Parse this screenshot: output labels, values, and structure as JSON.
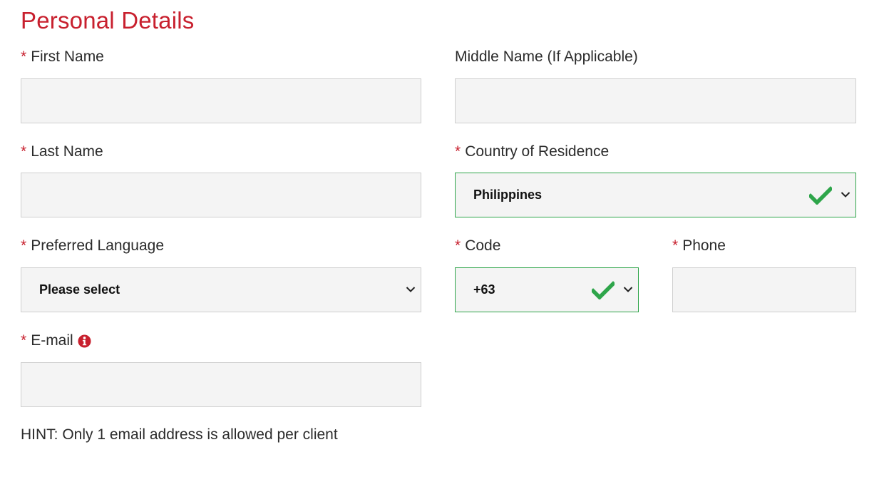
{
  "form": {
    "title": "Personal Details",
    "required_marker": "*",
    "first_name": {
      "label": "First Name",
      "value": ""
    },
    "middle_name": {
      "label": "Middle Name (If Applicable)",
      "value": ""
    },
    "last_name": {
      "label": "Last Name",
      "value": ""
    },
    "country": {
      "label": "Country of Residence",
      "value": "Philippines"
    },
    "language": {
      "label": "Preferred Language",
      "value": "Please select"
    },
    "code": {
      "label": "Code",
      "value": "+63"
    },
    "phone": {
      "label": "Phone",
      "value": ""
    },
    "email": {
      "label": "E-mail",
      "value": ""
    },
    "hint": "HINT: Only 1 email address is allowed per client"
  },
  "colors": {
    "accent_red": "#c8202e",
    "valid_green": "#2ea54a",
    "field_bg": "#f4f4f4",
    "field_border": "#cfcfcf"
  },
  "icons": {
    "valid": "checkmark-icon",
    "dropdown": "chevron-down-icon",
    "info": "info-icon"
  }
}
